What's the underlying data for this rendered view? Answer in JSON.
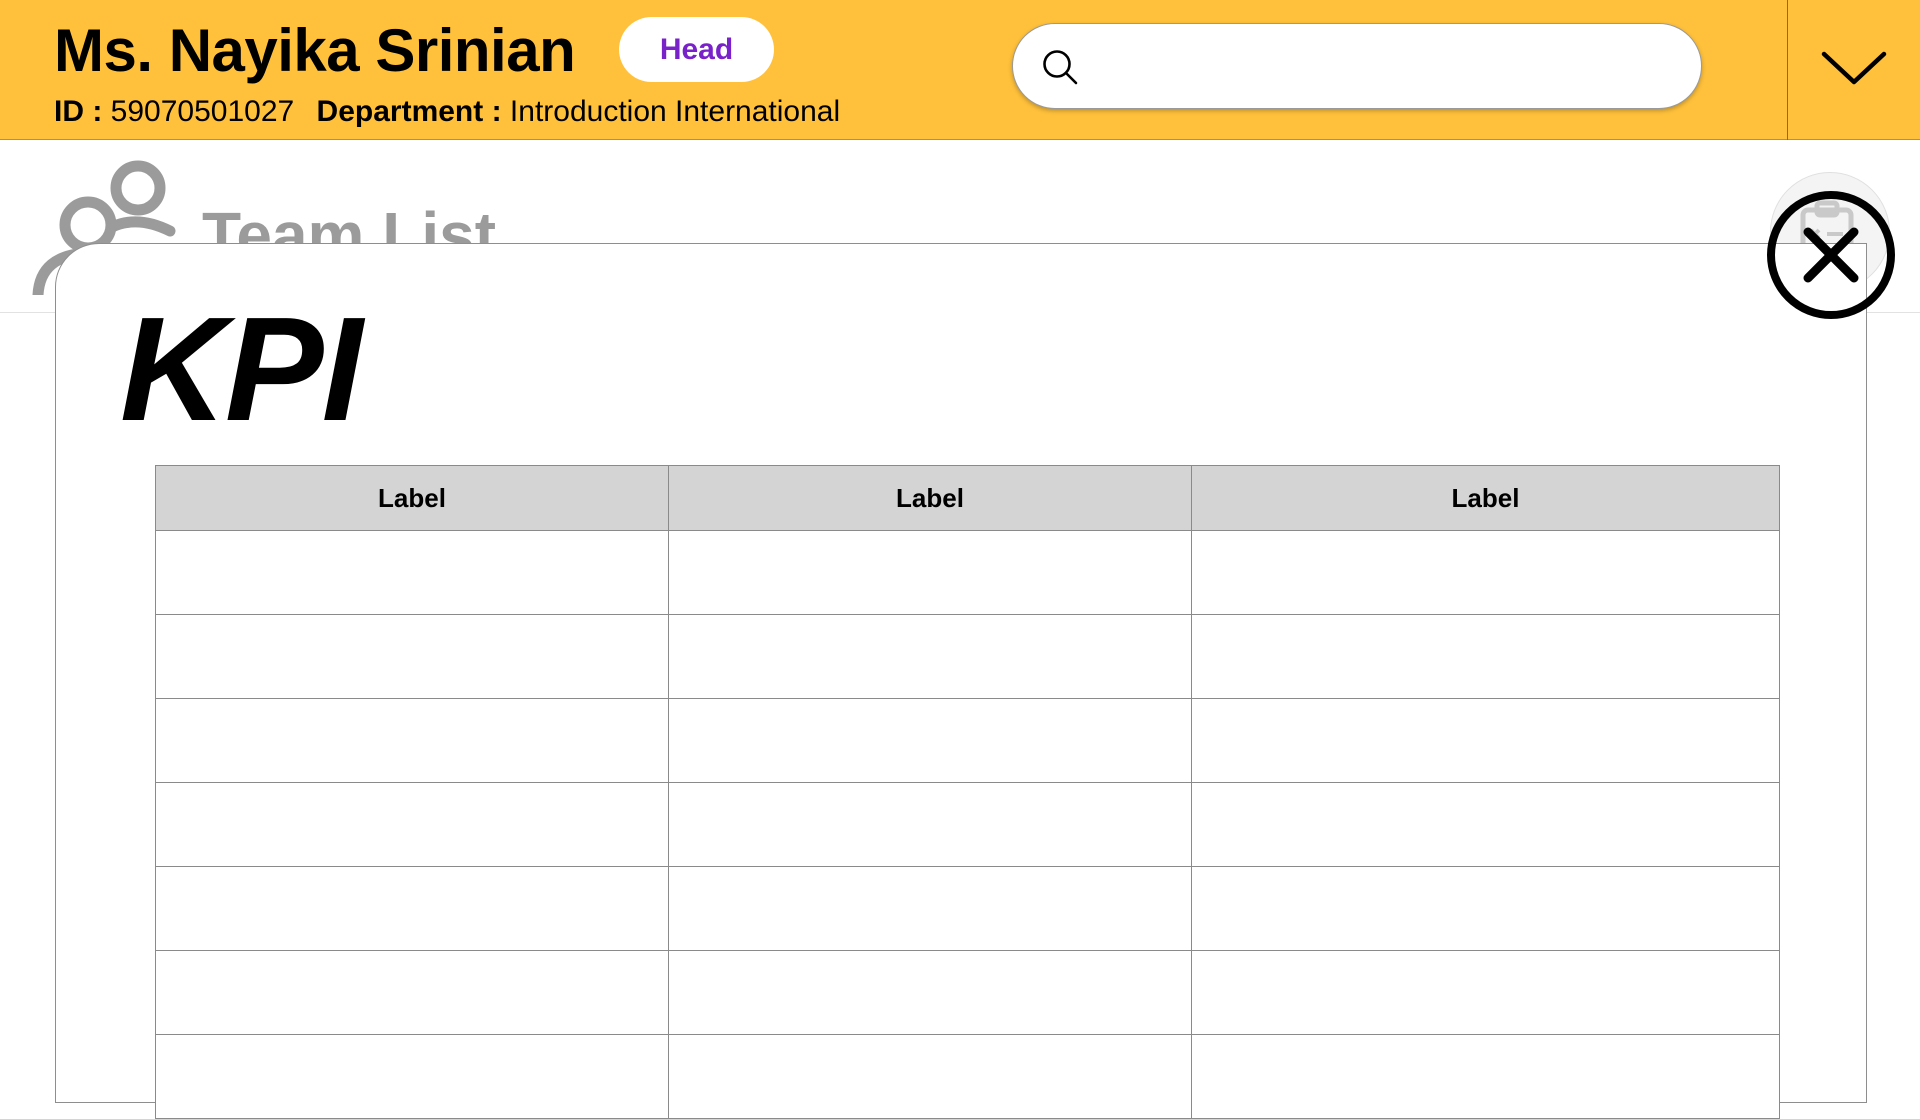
{
  "header": {
    "name": "Ms. Nayika Srinian",
    "role_badge": "Head",
    "id_label": "ID :",
    "id_value": "59070501027",
    "department_label": "Department :",
    "department_value": "Introduction International",
    "search": {
      "placeholder": "",
      "value": "",
      "icon": "search-icon"
    },
    "menu_icon": "chevron-down-icon"
  },
  "background_page": {
    "title": "Team List",
    "title_icon": "team-icon",
    "action_icon": "clipboard-report-icon"
  },
  "modal": {
    "title": "KPI",
    "close_icon": "close-circle-icon",
    "table": {
      "columns": [
        "Label",
        "Label",
        "Label"
      ],
      "rows": [
        [
          "",
          "",
          ""
        ],
        [
          "",
          "",
          ""
        ],
        [
          "",
          "",
          ""
        ],
        [
          "",
          "",
          ""
        ],
        [
          "",
          "",
          ""
        ],
        [
          "",
          "",
          ""
        ],
        [
          "",
          "",
          ""
        ]
      ]
    }
  },
  "colors": {
    "header_bg": "#ffc13b",
    "badge_text": "#7a22c9",
    "table_header_bg": "#d4d4d4",
    "muted_text": "#9b9b9b"
  }
}
